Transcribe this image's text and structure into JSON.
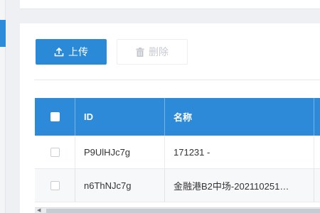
{
  "toolbar": {
    "upload_label": "上传",
    "delete_label": "删除"
  },
  "table": {
    "columns": [
      "ID",
      "名称"
    ],
    "rows": [
      {
        "id": "P9UlHJc7g",
        "name": "171231 -"
      },
      {
        "id": "n6ThNJc7g",
        "name": "金融港B2中场-202110251…"
      }
    ]
  },
  "colors": {
    "primary": "#2b8ad7",
    "header": "#2d8ad8"
  },
  "icons": {
    "upload": "upload-icon",
    "delete": "trash-icon"
  }
}
